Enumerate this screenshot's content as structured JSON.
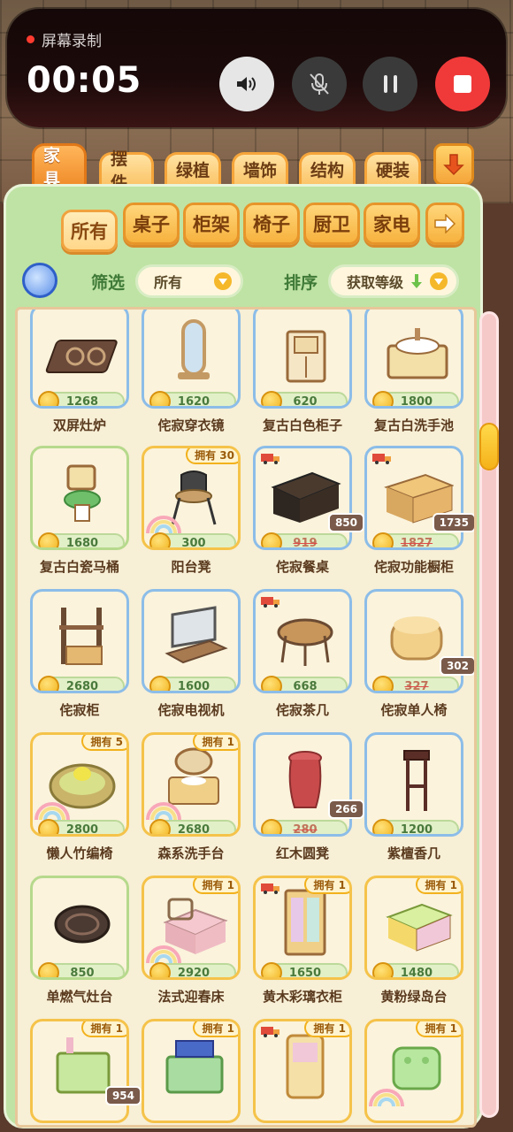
{
  "recorder": {
    "label": "屏幕录制",
    "time": "00:05"
  },
  "category_tabs": [
    {
      "label": "家具",
      "active": true
    },
    {
      "label": "摆件",
      "active": false
    },
    {
      "label": "绿植",
      "active": false
    },
    {
      "label": "墙饰",
      "active": false
    },
    {
      "label": "结构",
      "active": false
    },
    {
      "label": "硬装",
      "active": false
    }
  ],
  "sub_tabs": [
    {
      "label": "所有",
      "active": true
    },
    {
      "label": "桌子",
      "active": false
    },
    {
      "label": "柜架",
      "active": false
    },
    {
      "label": "椅子",
      "active": false
    },
    {
      "label": "厨卫",
      "active": false
    },
    {
      "label": "家电",
      "active": false
    }
  ],
  "filter": {
    "filter_label": "筛选",
    "filter_value": "所有",
    "sort_label": "排序",
    "sort_value": "获取等级"
  },
  "items": [
    {
      "name": "双屏灶炉",
      "price": "1268",
      "owned": "",
      "sale": "",
      "art": "stove2"
    },
    {
      "name": "侘寂穿衣镜",
      "price": "1620",
      "owned": "",
      "sale": "",
      "art": "mirror"
    },
    {
      "name": "复古白色柜子",
      "price": "620",
      "owned": "",
      "sale": "",
      "art": "cabinet-white"
    },
    {
      "name": "复古白洗手池",
      "price": "1800",
      "owned": "",
      "sale": "",
      "art": "sink-white"
    },
    {
      "name": "复古白瓷马桶",
      "price": "1680",
      "owned": "",
      "sale": "",
      "art": "toilet"
    },
    {
      "name": "阳台凳",
      "price": "300",
      "owned": "拥有 30",
      "sale": "",
      "art": "chair"
    },
    {
      "name": "侘寂餐桌",
      "price": "919",
      "owned": "",
      "sale": "850",
      "art": "dining-table"
    },
    {
      "name": "侘寂功能橱柜",
      "price": "1827",
      "owned": "",
      "sale": "1735",
      "art": "cupboard"
    },
    {
      "name": "侘寂柜",
      "price": "2680",
      "owned": "",
      "sale": "",
      "art": "shelf"
    },
    {
      "name": "侘寂电视机",
      "price": "1600",
      "owned": "",
      "sale": "",
      "art": "tv"
    },
    {
      "name": "侘寂茶几",
      "price": "668",
      "owned": "",
      "sale": "",
      "art": "tea-table"
    },
    {
      "name": "侘寂单人椅",
      "price": "327",
      "owned": "",
      "sale": "302",
      "art": "ottoman"
    },
    {
      "name": "懒人竹编椅",
      "price": "2800",
      "owned": "拥有 5",
      "sale": "",
      "art": "papasan"
    },
    {
      "name": "森系洗手台",
      "price": "2680",
      "owned": "拥有 1",
      "sale": "",
      "art": "vanity"
    },
    {
      "name": "红木圆凳",
      "price": "280",
      "owned": "",
      "sale": "266",
      "art": "stool"
    },
    {
      "name": "紫檀香几",
      "price": "1200",
      "owned": "",
      "sale": "",
      "art": "incense-stand"
    },
    {
      "name": "单燃气灶台",
      "price": "850",
      "owned": "",
      "sale": "",
      "art": "stove1"
    },
    {
      "name": "法式迎春床",
      "price": "2920",
      "owned": "拥有 1",
      "sale": "",
      "art": "bed"
    },
    {
      "name": "黄木彩璃衣柜",
      "price": "1650",
      "owned": "拥有 1",
      "sale": "",
      "art": "wardrobe"
    },
    {
      "name": "黄粉绿岛台",
      "price": "1480",
      "owned": "拥有 1",
      "sale": "",
      "art": "island"
    },
    {
      "name": "",
      "price": "",
      "owned": "拥有 1",
      "sale": "954",
      "art": "green-counter"
    },
    {
      "name": "",
      "price": "",
      "owned": "拥有 1",
      "sale": "",
      "art": "green-stove"
    },
    {
      "name": "",
      "price": "",
      "owned": "拥有 1",
      "sale": "",
      "art": "arcade"
    },
    {
      "name": "",
      "price": "",
      "owned": "拥有 1",
      "sale": "",
      "art": "green-ottoman"
    }
  ]
}
